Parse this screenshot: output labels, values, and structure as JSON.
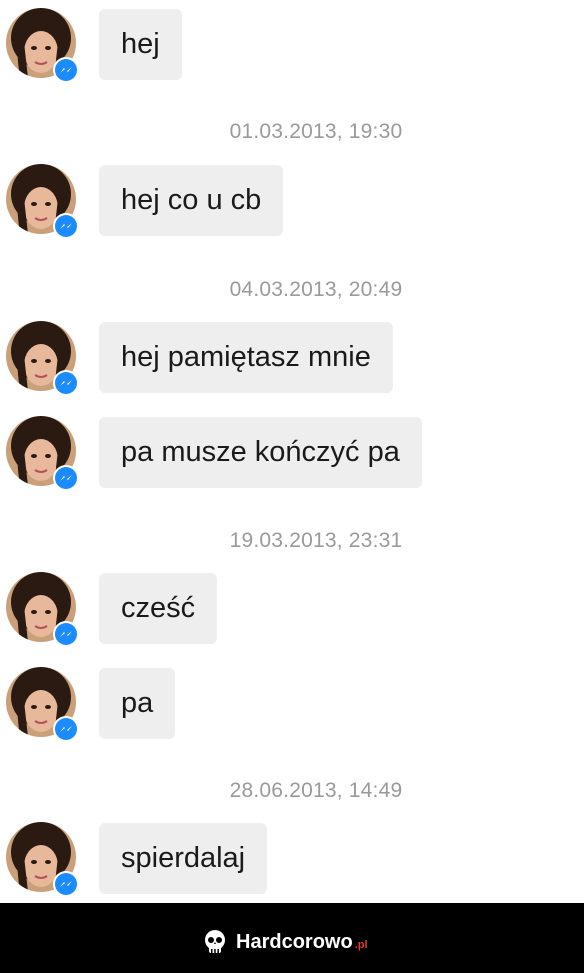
{
  "messages": [
    {
      "text": "hej"
    },
    {
      "text": "hej co u cb"
    },
    {
      "text": "hej pamiętasz mnie"
    },
    {
      "text": "pa musze kończyć pa"
    },
    {
      "text": "cześć"
    },
    {
      "text": "pa"
    },
    {
      "text": "spierdalaj"
    }
  ],
  "timestamps": [
    {
      "text": "01.03.2013, 19:30"
    },
    {
      "text": "04.03.2013, 20:49"
    },
    {
      "text": "19.03.2013, 23:31"
    },
    {
      "text": "28.06.2013, 14:49"
    }
  ],
  "footer": {
    "brand": "Hardcorowo",
    "tld": ".pl"
  },
  "colors": {
    "bubble": "#eeeeee",
    "badge": "#1a8cff",
    "footer_bg": "#000000",
    "accent": "#e03a2e"
  },
  "icons": {
    "avatar": "profile-photo",
    "badge": "messenger-icon",
    "logo": "skull-icon"
  }
}
